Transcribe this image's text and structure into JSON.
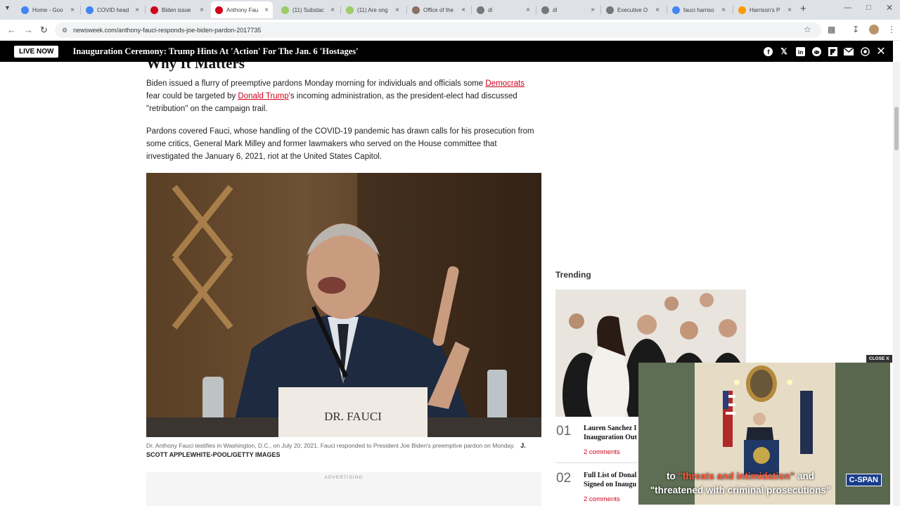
{
  "browser": {
    "tabs": [
      {
        "title": "Home - Goo",
        "icon": "google-drive-icon",
        "color": "#4285f4"
      },
      {
        "title": "COVID head",
        "icon": "google-docs-icon",
        "color": "#4285f4"
      },
      {
        "title": "Biden issue",
        "icon": "red-cross-icon",
        "color": "#d0021b"
      },
      {
        "title": "Anthony Fau",
        "icon": "newsweek-icon",
        "color": "#d0021b"
      },
      {
        "title": "(11) Substac",
        "icon": "globe-green-icon",
        "color": "#9ccc65"
      },
      {
        "title": "(11) Are ong",
        "icon": "globe-green-icon",
        "color": "#9ccc65"
      },
      {
        "title": "Office of the",
        "icon": "seal-icon",
        "color": "#8d6e63"
      },
      {
        "title": "dl",
        "icon": "globe-icon",
        "color": "#777777"
      },
      {
        "title": "dl",
        "icon": "globe-icon",
        "color": "#777777"
      },
      {
        "title": "Executive O",
        "icon": "globe-icon",
        "color": "#777777"
      },
      {
        "title": "fauci harriso",
        "icon": "google-icon",
        "color": "#4285f4"
      },
      {
        "title": "Harrison's P",
        "icon": "amazon-icon",
        "color": "#ff9900"
      }
    ],
    "url": "newsweek.com/anthony-fauci-responds-joe-biden-pardon-2017735"
  },
  "live_bar": {
    "badge": "LIVE NOW",
    "headline": "Inauguration Ceremony: Trump Hints At 'Action' For The Jan. 6 'Hostages'",
    "share_icons": [
      "facebook-icon",
      "x-icon",
      "linkedin-icon",
      "reddit-icon",
      "flipboard-icon",
      "email-icon",
      "whatsapp-icon"
    ]
  },
  "article": {
    "section_heading": "Why It Matters",
    "p1_before": "Biden issued a flurry of preemptive pardons Monday morning for individuals and officials some ",
    "p1_link1": "Democrats",
    "p1_mid": " fear could be targeted by ",
    "p1_link2": "Donald Trump",
    "p1_after": "'s incoming administration, as the president-elect had discussed \"retribution\" on the campaign trail.",
    "p2": "Pardons covered Fauci, whose handling of the COVID-19 pandemic has drawn calls for his prosecution from some critics, General Mark Milley and former lawmakers who served on the House committee that investigated the January 6, 2021, riot at the United States Capitol.",
    "photo_placard": "DR. FAUCI",
    "caption": "Dr. Anthony Fauci testifies in Washington, D.C., on July 20, 2021. Fauci responded to President Joe Biden's preemptive pardon on Monday.",
    "credit": "J. SCOTT APPLEWHITE-POOL/GETTY IMAGES",
    "ad_label": "ADVERTISING"
  },
  "trending": {
    "heading": "Trending",
    "items": [
      {
        "num": "01",
        "title_l1": "Lauren Sanchez I",
        "title_l2": "Inauguration Out",
        "comments": "2 comments"
      },
      {
        "num": "02",
        "title_l1": "Full List of Donal",
        "title_l2": "Signed on Inaugu",
        "comments": "2 comments"
      }
    ]
  },
  "video_player": {
    "close_label": "CLOSE X",
    "caption_l1_pre": "to ",
    "caption_l1_hl": "\"threats and intimidation\"",
    "caption_l1_post": " and",
    "caption_l2": "\"threatened with criminal prosecutions\"",
    "network_logo": "C-SPAN"
  }
}
